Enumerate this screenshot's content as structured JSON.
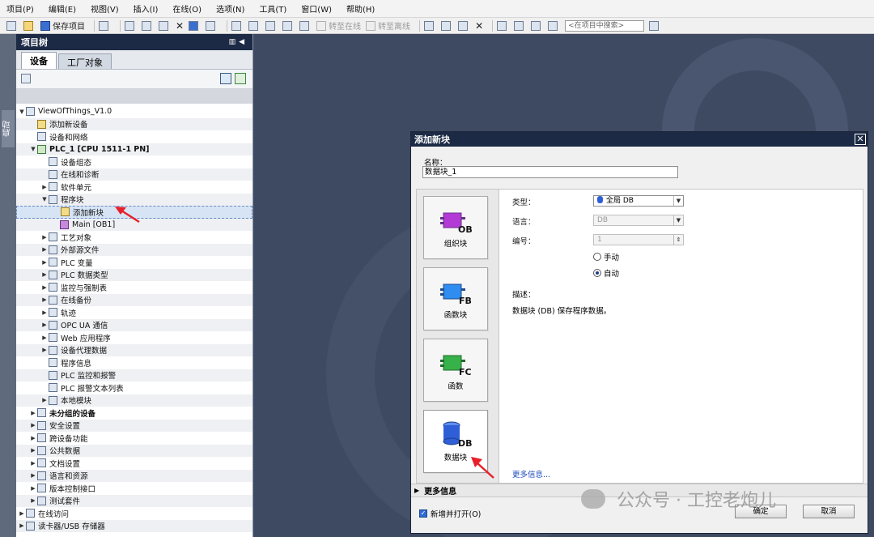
{
  "menu": [
    "项目(P)",
    "编辑(E)",
    "视图(V)",
    "插入(I)",
    "在线(O)",
    "选项(N)",
    "工具(T)",
    "窗口(W)",
    "帮助(H)"
  ],
  "toolbar": {
    "save_project": "保存项目",
    "go_online": "转至在线",
    "go_offline": "转至离线",
    "search_placeholder": "<在项目中搜索>"
  },
  "left_strip": {
    "tab": "启动"
  },
  "project_tree": {
    "title": "项目树",
    "tabs": [
      "设备",
      "工厂对象"
    ],
    "items": [
      {
        "label": "ViewOfThings_V1.0",
        "level": 0,
        "arrow": "▼",
        "icon": "project"
      },
      {
        "label": "添加新设备",
        "level": 1,
        "arrow": "",
        "icon": "add-device"
      },
      {
        "label": "设备和网络",
        "level": 1,
        "arrow": "",
        "icon": "network"
      },
      {
        "label": "PLC_1 [CPU 1511-1 PN]",
        "level": 1,
        "arrow": "▼",
        "icon": "plc",
        "bold": true
      },
      {
        "label": "设备组态",
        "level": 2,
        "arrow": "",
        "icon": "device-config"
      },
      {
        "label": "在线和诊断",
        "level": 2,
        "arrow": "",
        "icon": "diagnostics"
      },
      {
        "label": "软件单元",
        "level": 2,
        "arrow": "▶",
        "icon": "folder"
      },
      {
        "label": "程序块",
        "level": 2,
        "arrow": "▼",
        "icon": "folder"
      },
      {
        "label": "添加新块",
        "level": 3,
        "arrow": "",
        "icon": "add-block",
        "selected": true
      },
      {
        "label": "Main [OB1]",
        "level": 3,
        "arrow": "",
        "icon": "ob"
      },
      {
        "label": "工艺对象",
        "level": 2,
        "arrow": "▶",
        "icon": "folder"
      },
      {
        "label": "外部源文件",
        "level": 2,
        "arrow": "▶",
        "icon": "folder"
      },
      {
        "label": "PLC 变量",
        "level": 2,
        "arrow": "▶",
        "icon": "folder"
      },
      {
        "label": "PLC 数据类型",
        "level": 2,
        "arrow": "▶",
        "icon": "folder"
      },
      {
        "label": "监控与强制表",
        "level": 2,
        "arrow": "▶",
        "icon": "folder"
      },
      {
        "label": "在线备份",
        "level": 2,
        "arrow": "▶",
        "icon": "folder"
      },
      {
        "label": "轨迹",
        "level": 2,
        "arrow": "▶",
        "icon": "folder"
      },
      {
        "label": "OPC UA 通信",
        "level": 2,
        "arrow": "▶",
        "icon": "folder"
      },
      {
        "label": "Web 应用程序",
        "level": 2,
        "arrow": "▶",
        "icon": "folder"
      },
      {
        "label": "设备代理数据",
        "level": 2,
        "arrow": "▶",
        "icon": "folder"
      },
      {
        "label": "程序信息",
        "level": 2,
        "arrow": "",
        "icon": "program-info"
      },
      {
        "label": "PLC 监控和报警",
        "level": 2,
        "arrow": "",
        "icon": "alarm"
      },
      {
        "label": "PLC 报警文本列表",
        "level": 2,
        "arrow": "",
        "icon": "alarm-text"
      },
      {
        "label": "本地模块",
        "level": 2,
        "arrow": "▶",
        "icon": "folder"
      },
      {
        "label": "未分组的设备",
        "level": 1,
        "arrow": "▶",
        "icon": "folder",
        "bold": true
      },
      {
        "label": "安全设置",
        "level": 1,
        "arrow": "▶",
        "icon": "folder"
      },
      {
        "label": "跨设备功能",
        "level": 1,
        "arrow": "▶",
        "icon": "folder"
      },
      {
        "label": "公共数据",
        "level": 1,
        "arrow": "▶",
        "icon": "folder"
      },
      {
        "label": "文档设置",
        "level": 1,
        "arrow": "▶",
        "icon": "folder"
      },
      {
        "label": "语言和资源",
        "level": 1,
        "arrow": "▶",
        "icon": "folder"
      },
      {
        "label": "版本控制接口",
        "level": 1,
        "arrow": "▶",
        "icon": "folder"
      },
      {
        "label": "测试套件",
        "level": 1,
        "arrow": "▶",
        "icon": "folder"
      },
      {
        "label": "在线访问",
        "level": 0,
        "arrow": "▶",
        "icon": "folder"
      },
      {
        "label": "读卡器/USB 存储器",
        "level": 0,
        "arrow": "▶",
        "icon": "folder"
      }
    ]
  },
  "dialog": {
    "title": "添加新块",
    "name_label": "名称：",
    "name_value": "数据块_1",
    "block_types": [
      {
        "id": "OB",
        "label": "组织块",
        "color": "#b23bd6"
      },
      {
        "id": "FB",
        "label": "函数块",
        "color": "#2f8cf0"
      },
      {
        "id": "FC",
        "label": "函数",
        "color": "#37b24a"
      },
      {
        "id": "DB",
        "label": "数据块",
        "color": "#2f5fd6"
      }
    ],
    "form": {
      "type_label": "类型：",
      "type_value": "全局 DB",
      "language_label": "语言：",
      "language_value": "DB",
      "number_label": "编号：",
      "number_value": "1",
      "manual_label": "手动",
      "auto_label": "自动",
      "description_label": "描述：",
      "description_text": "数据块 (DB) 保存程序数据。",
      "more_link": "更多信息..."
    },
    "more_info": "更多信息",
    "open_checkbox": "新增并打开(O)",
    "ok": "确定",
    "cancel": "取消"
  },
  "watermark": "公众号 · 工控老炮儿",
  "colors": {
    "title_bar": "#1c2a45",
    "workspace": "#3e4a62",
    "annotation_arrow": "#e8202a"
  }
}
